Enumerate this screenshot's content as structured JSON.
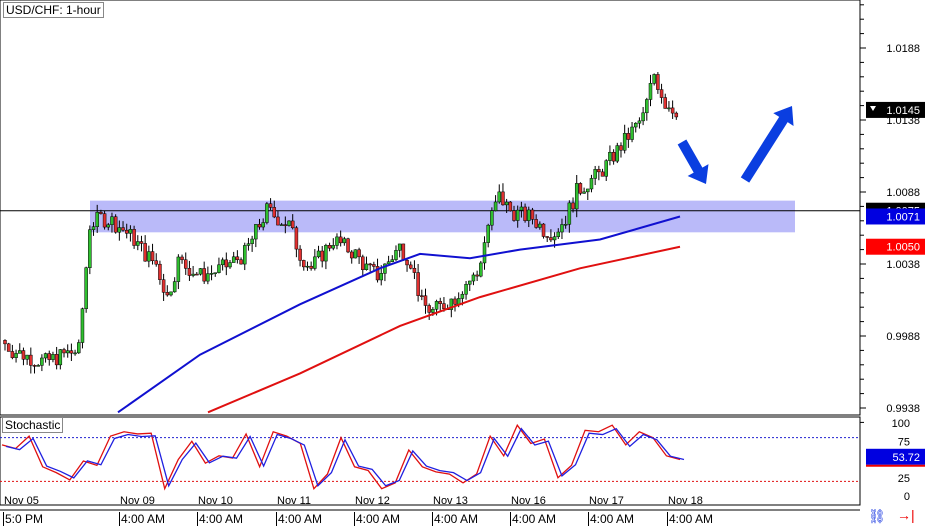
{
  "chart_data": [
    {
      "type": "candlestick",
      "title": "USD/CHF: 1-hour",
      "yticks": [
        1.0188,
        1.0138,
        1.0088,
        1.0038,
        0.9988,
        0.9938
      ],
      "ylim": [
        0.9928,
        1.022
      ],
      "closes": [
        0.9985,
        0.9978,
        0.9975,
        0.9972,
        0.997,
        0.9973,
        0.9976,
        0.9978,
        1.0065,
        1.007,
        1.0068,
        1.0062,
        1.0055,
        1.0045,
        1.0038,
        1.0015,
        1.004,
        1.0035,
        1.003,
        1.0032,
        1.0035,
        1.004,
        1.0045,
        1.006,
        1.0075,
        1.007,
        1.0065,
        1.0045,
        1.0035,
        1.0045,
        1.0055,
        1.005,
        1.0045,
        1.0035,
        1.003,
        1.004,
        1.005,
        1.004,
        1.001,
        1.0005,
        1.001,
        1.0015,
        1.0025,
        1.003,
        1.0065,
        1.0085,
        1.0075,
        1.0072,
        1.007,
        1.0062,
        1.006,
        1.007,
        1.0088,
        1.0095,
        1.01,
        1.011,
        1.012,
        1.013,
        1.014,
        1.017,
        1.015,
        1.0145
      ],
      "sma_blue": [
        [
          0,
          0.9935
        ],
        [
          82,
          0.9975
        ],
        [
          182,
          1.001
        ],
        [
          262,
          1.0035
        ],
        [
          302,
          1.0045
        ],
        [
          352,
          1.0042
        ],
        [
          402,
          1.0048
        ],
        [
          482,
          1.0055
        ],
        [
          562,
          1.0071
        ]
      ],
      "sma_red": [
        [
          90,
          0.9935
        ],
        [
          182,
          0.9962
        ],
        [
          282,
          0.9995
        ],
        [
          362,
          1.0015
        ],
        [
          462,
          1.0035
        ],
        [
          562,
          1.005
        ]
      ],
      "zone": [
        1.006,
        1.0082
      ],
      "hline": 1.0075,
      "price_labels": [
        {
          "value": "1.0145",
          "color": "#000000"
        },
        {
          "value": "1.0075",
          "color": "#000000"
        },
        {
          "value": "1.0071",
          "color": "#0000e0"
        },
        {
          "value": "1.0050",
          "color": "#ff0000"
        }
      ]
    },
    {
      "type": "line",
      "title": "Stochastic",
      "ylim": [
        0,
        100
      ],
      "yticks": [
        100,
        75,
        50,
        25,
        0
      ],
      "levels": [
        80,
        20
      ],
      "k": [
        70,
        65,
        82,
        40,
        32,
        22,
        48,
        42,
        82,
        88,
        85,
        86,
        10,
        50,
        75,
        45,
        55,
        52,
        85,
        40,
        88,
        82,
        72,
        10,
        30,
        80,
        40,
        35,
        10,
        18,
        63,
        40,
        33,
        30,
        18,
        30,
        82,
        55,
        97,
        72,
        78,
        25,
        42,
        90,
        88,
        97,
        70,
        88,
        80,
        55,
        50
      ],
      "current": "53.72"
    }
  ],
  "x_labels": [
    "Nov 05",
    "Nov 09",
    "Nov 10",
    "Nov 11",
    "Nov 12",
    "Nov 13",
    "Nov 16",
    "Nov 17",
    "Nov 18"
  ],
  "time_labels": [
    "5:0 PM",
    "4:00 AM",
    "4:00 AM",
    "4:00 AM",
    "4:00 AM",
    "4:00 AM",
    "4:00 AM",
    "4:00 AM",
    "4:00 AM"
  ]
}
